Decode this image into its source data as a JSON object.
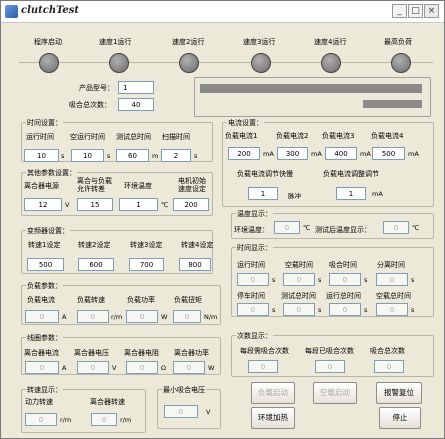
{
  "window": {
    "title": "clutchTest",
    "min": "_",
    "max": "□",
    "close": "×"
  },
  "status": {
    "labels": [
      "程序启动",
      "速度1运行",
      "速度2运行",
      "速度3运行",
      "速度4运行",
      "最高负荷"
    ]
  },
  "product": {
    "type_label": "产品型号：",
    "type_value": "1",
    "count_label": "吸合总次数：",
    "count_value": "40"
  },
  "time_settings": {
    "title": "时间设置：",
    "items": [
      {
        "label": "运行时间",
        "value": "10",
        "unit": "s"
      },
      {
        "label": "空运行时间",
        "value": "10",
        "unit": "s"
      },
      {
        "label": "测试总时间",
        "value": "60",
        "unit": "m"
      },
      {
        "label": "扫描时间",
        "value": "2",
        "unit": "s"
      }
    ]
  },
  "current_settings": {
    "title": "电流设置：",
    "items": [
      {
        "label": "负载电流1",
        "value": "200",
        "unit": "mA"
      },
      {
        "label": "负载电流2",
        "value": "300",
        "unit": "mA"
      },
      {
        "label": "负载电流3",
        "value": "400",
        "unit": "mA"
      },
      {
        "label": "负载电流4",
        "value": "500",
        "unit": "mA"
      }
    ],
    "fast_label": "负载电流调节快慢",
    "fast_value": "1",
    "fast_unit": "脉冲",
    "exc_label": "负载电流调整调节",
    "exc_value": "1",
    "exc_unit": "mA"
  },
  "other_params": {
    "title": "其他参数设置：",
    "items": [
      {
        "label": "离合器电源",
        "value": "12",
        "unit": "V"
      },
      {
        "label": "离合与负载允许转差",
        "value": "15",
        "unit": ""
      },
      {
        "label": "环境温度",
        "value": "1",
        "unit": "℃"
      },
      {
        "label": "电机初始速度设定",
        "value": "200",
        "unit": ""
      }
    ]
  },
  "temp_display": {
    "title": "温度显示：",
    "env_label": "环境温度：",
    "env_value": "0",
    "env_unit": "℃",
    "post_label": "测试后温度显示：",
    "post_value": "0",
    "post_unit": "℃"
  },
  "speed_settings": {
    "title": "变频器设置：",
    "items": [
      {
        "label": "转速1设定",
        "value": "500"
      },
      {
        "label": "转速2设定",
        "value": "600"
      },
      {
        "label": "转速3设定",
        "value": "700"
      },
      {
        "label": "转速4设定",
        "value": "800"
      }
    ]
  },
  "time_display": {
    "title": "时间显示：",
    "row1": [
      {
        "label": "运行时间",
        "value": "0",
        "unit": "s"
      },
      {
        "label": "空载时间",
        "value": "0",
        "unit": "s"
      },
      {
        "label": "吸合时间",
        "value": "0",
        "unit": "s"
      },
      {
        "label": "分离时间",
        "value": "0",
        "unit": "s"
      }
    ],
    "row2": [
      {
        "label": "停车时间",
        "value": "0",
        "unit": "s"
      },
      {
        "label": "测试总时间",
        "value": "0",
        "unit": "s"
      },
      {
        "label": "运行总时间",
        "value": "0",
        "unit": "s"
      },
      {
        "label": "空载总时间",
        "value": "0",
        "unit": "s"
      }
    ]
  },
  "load_params": {
    "title": "负载参数：",
    "items": [
      {
        "label": "负载电流",
        "value": "0",
        "unit": "A"
      },
      {
        "label": "负载转速",
        "value": "0",
        "unit": "r/m"
      },
      {
        "label": "负载功率",
        "value": "0",
        "unit": "W"
      },
      {
        "label": "负载扭矩",
        "value": "0",
        "unit": "N/m"
      }
    ]
  },
  "count_display": {
    "title": "次数显示：",
    "items": [
      {
        "label": "每段需吸合次数",
        "value": "0"
      },
      {
        "label": "每段已吸合次数",
        "value": "0"
      },
      {
        "label": "吸合总次数",
        "value": "0"
      }
    ]
  },
  "coil_params": {
    "title": "线圈参数：",
    "items": [
      {
        "label": "离合器电流",
        "value": "0",
        "unit": "A"
      },
      {
        "label": "离合器电压",
        "value": "0",
        "unit": "V"
      },
      {
        "label": "离合器电阻",
        "value": "0",
        "unit": "Ω"
      },
      {
        "label": "离合器功率",
        "value": "0",
        "unit": "W"
      }
    ]
  },
  "speed_display": {
    "title": "转速显示：",
    "items": [
      {
        "label": "动力转速",
        "value": "0",
        "unit": "r/m"
      },
      {
        "label": "离合器转速",
        "value": "0",
        "unit": "r/m"
      }
    ]
  },
  "min_voltage": {
    "title": "最小吸合电压",
    "value": "0",
    "unit": "V"
  },
  "buttons": {
    "load_start": "负载启动",
    "idle_start": "空载启动",
    "alarm_reset": "报警复位",
    "env_heat": "环境加热",
    "stop": "停止"
  }
}
